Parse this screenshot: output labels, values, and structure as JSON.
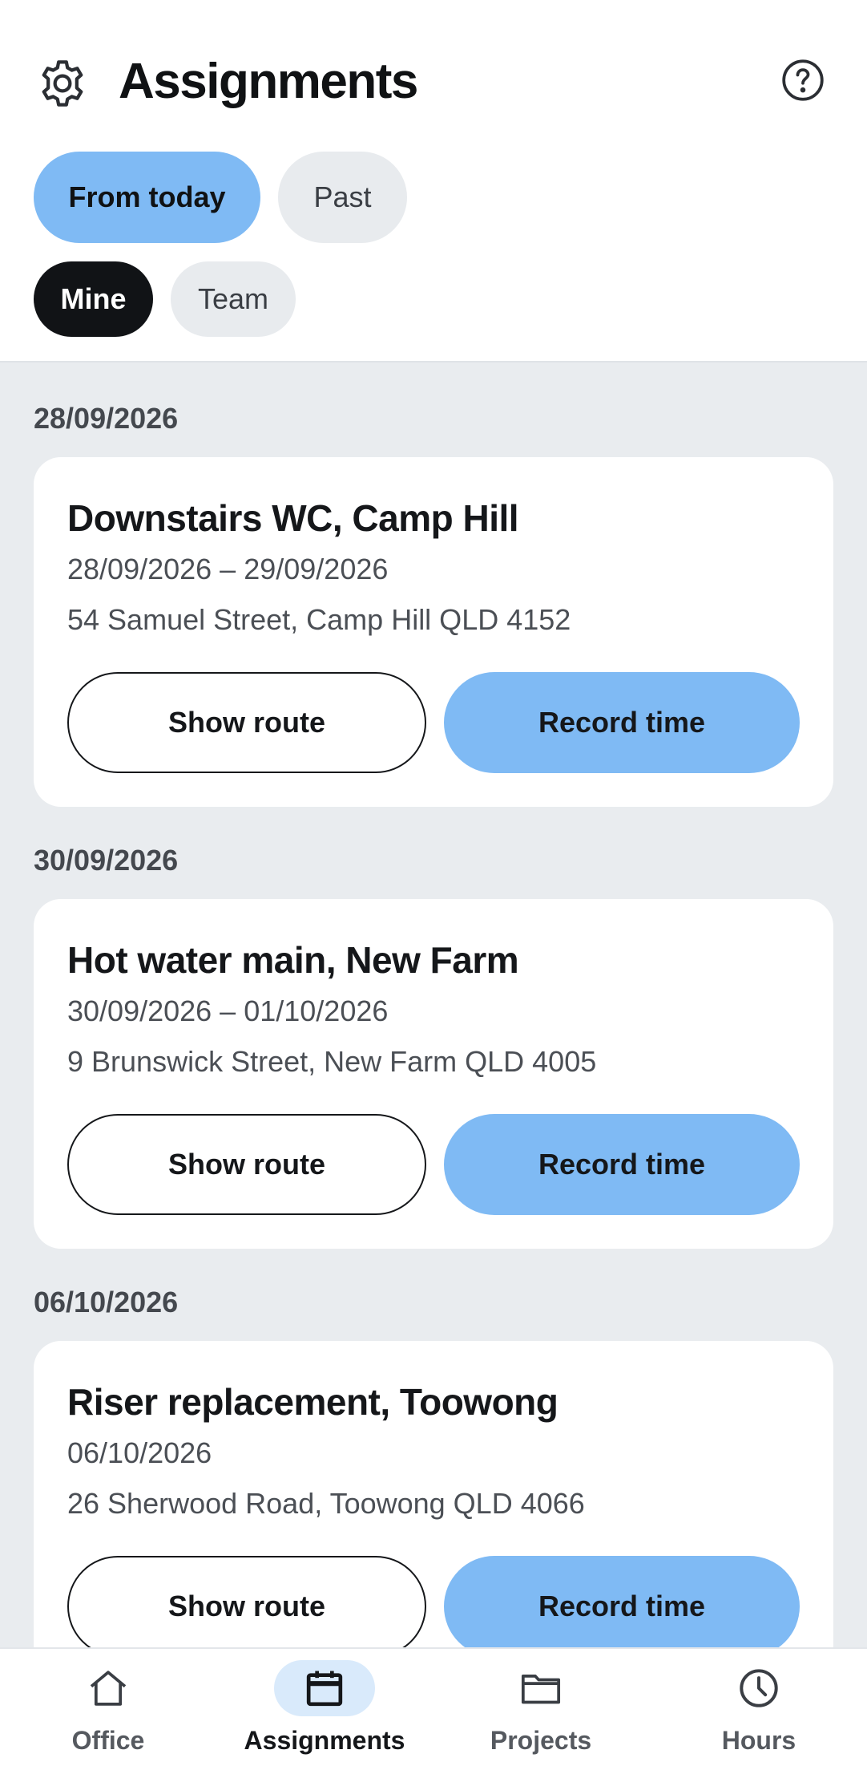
{
  "header": {
    "title": "Assignments",
    "settings_icon": "gear-icon",
    "help_icon": "help-circle-icon"
  },
  "filters": {
    "time": [
      {
        "label": "From today",
        "selected": true
      },
      {
        "label": "Past",
        "selected": false
      }
    ],
    "scope": [
      {
        "label": "Mine",
        "selected": true
      },
      {
        "label": "Team",
        "selected": false
      }
    ]
  },
  "groups": [
    {
      "date": "28/09/2026",
      "assignment": {
        "title": "Downstairs WC, Camp Hill",
        "dates": "28/09/2026 – 29/09/2026",
        "address": "54 Samuel Street, Camp Hill QLD 4152",
        "route_label": "Show route",
        "record_label": "Record time"
      }
    },
    {
      "date": "30/09/2026",
      "assignment": {
        "title": "Hot water main, New Farm",
        "dates": "30/09/2026 – 01/10/2026",
        "address": "9 Brunswick Street, New Farm QLD 4005",
        "route_label": "Show route",
        "record_label": "Record time"
      }
    },
    {
      "date": "06/10/2026",
      "assignment": {
        "title": "Riser replacement, Toowong",
        "dates": "06/10/2026",
        "address": "26 Sherwood Road, Toowong QLD 4066",
        "route_label": "Show route",
        "record_label": "Record time"
      }
    }
  ],
  "nav": [
    {
      "label": "Office",
      "icon": "home-icon",
      "active": false
    },
    {
      "label": "Assignments",
      "icon": "calendar-icon",
      "active": true
    },
    {
      "label": "Projects",
      "icon": "folder-icon",
      "active": false
    },
    {
      "label": "Hours",
      "icon": "clock-icon",
      "active": false
    }
  ],
  "colors": {
    "accent": "#7fbaf4",
    "active_chip": "#111316",
    "inactive_chip": "#e8ebee",
    "background": "#e9ecef",
    "nav_active_pill": "#d9eafb"
  }
}
